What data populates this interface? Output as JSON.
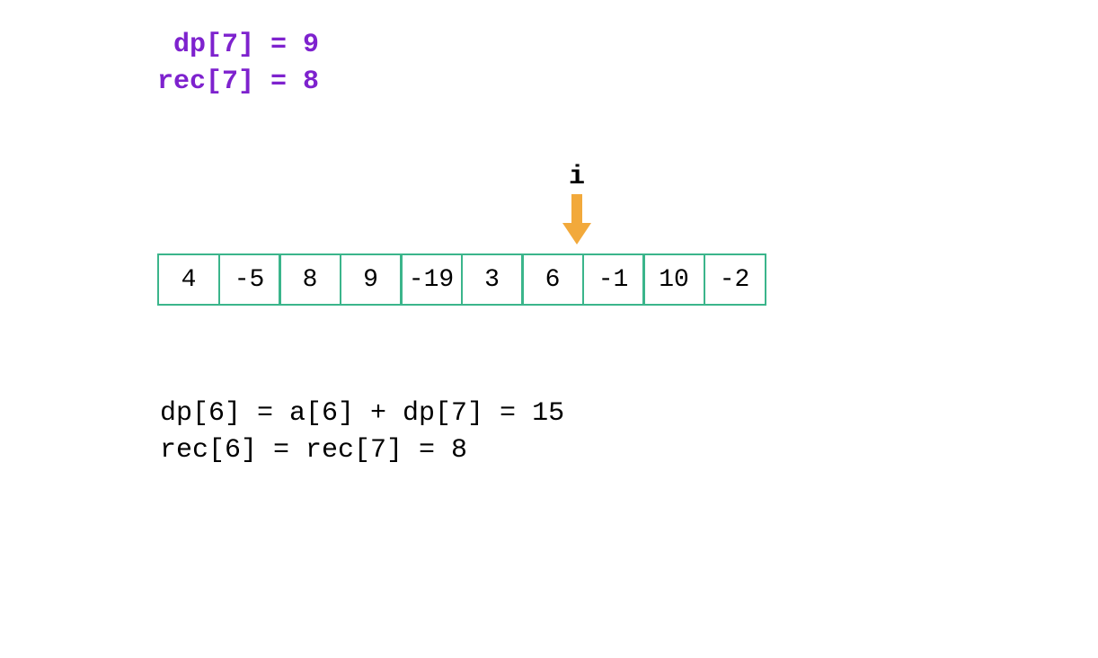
{
  "top": {
    "line1": " dp[7] = 9",
    "line2": "rec[7] = 8"
  },
  "pointer": {
    "label": "i",
    "index": 6,
    "arrow_color": "#f2a93b"
  },
  "array": {
    "border_color": "#3bb58b",
    "cells": [
      "4",
      "-5",
      "8",
      "9",
      "-19",
      "3",
      "6",
      "-1",
      "10",
      "-2"
    ]
  },
  "bottom": {
    "line1": "dp[6] = a[6] + dp[7] = 15",
    "line2": "rec[6] = rec[7] = 8"
  }
}
